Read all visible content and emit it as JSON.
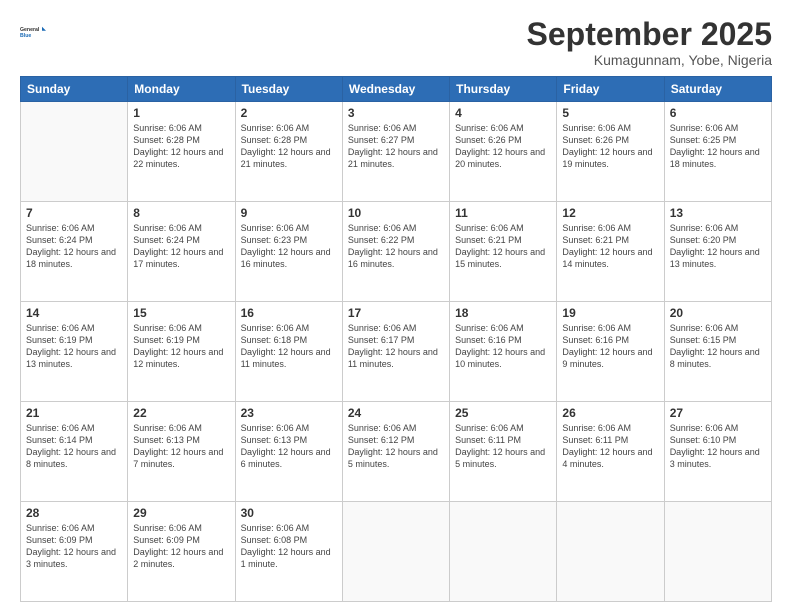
{
  "header": {
    "logo_line1": "General",
    "logo_line2": "Blue",
    "month": "September 2025",
    "location": "Kumagunnam, Yobe, Nigeria"
  },
  "weekdays": [
    "Sunday",
    "Monday",
    "Tuesday",
    "Wednesday",
    "Thursday",
    "Friday",
    "Saturday"
  ],
  "weeks": [
    [
      {
        "day": "",
        "sunrise": "",
        "sunset": "",
        "daylight": ""
      },
      {
        "day": "1",
        "sunrise": "Sunrise: 6:06 AM",
        "sunset": "Sunset: 6:28 PM",
        "daylight": "Daylight: 12 hours and 22 minutes."
      },
      {
        "day": "2",
        "sunrise": "Sunrise: 6:06 AM",
        "sunset": "Sunset: 6:28 PM",
        "daylight": "Daylight: 12 hours and 21 minutes."
      },
      {
        "day": "3",
        "sunrise": "Sunrise: 6:06 AM",
        "sunset": "Sunset: 6:27 PM",
        "daylight": "Daylight: 12 hours and 21 minutes."
      },
      {
        "day": "4",
        "sunrise": "Sunrise: 6:06 AM",
        "sunset": "Sunset: 6:26 PM",
        "daylight": "Daylight: 12 hours and 20 minutes."
      },
      {
        "day": "5",
        "sunrise": "Sunrise: 6:06 AM",
        "sunset": "Sunset: 6:26 PM",
        "daylight": "Daylight: 12 hours and 19 minutes."
      },
      {
        "day": "6",
        "sunrise": "Sunrise: 6:06 AM",
        "sunset": "Sunset: 6:25 PM",
        "daylight": "Daylight: 12 hours and 18 minutes."
      }
    ],
    [
      {
        "day": "7",
        "sunrise": "Sunrise: 6:06 AM",
        "sunset": "Sunset: 6:24 PM",
        "daylight": "Daylight: 12 hours and 18 minutes."
      },
      {
        "day": "8",
        "sunrise": "Sunrise: 6:06 AM",
        "sunset": "Sunset: 6:24 PM",
        "daylight": "Daylight: 12 hours and 17 minutes."
      },
      {
        "day": "9",
        "sunrise": "Sunrise: 6:06 AM",
        "sunset": "Sunset: 6:23 PM",
        "daylight": "Daylight: 12 hours and 16 minutes."
      },
      {
        "day": "10",
        "sunrise": "Sunrise: 6:06 AM",
        "sunset": "Sunset: 6:22 PM",
        "daylight": "Daylight: 12 hours and 16 minutes."
      },
      {
        "day": "11",
        "sunrise": "Sunrise: 6:06 AM",
        "sunset": "Sunset: 6:21 PM",
        "daylight": "Daylight: 12 hours and 15 minutes."
      },
      {
        "day": "12",
        "sunrise": "Sunrise: 6:06 AM",
        "sunset": "Sunset: 6:21 PM",
        "daylight": "Daylight: 12 hours and 14 minutes."
      },
      {
        "day": "13",
        "sunrise": "Sunrise: 6:06 AM",
        "sunset": "Sunset: 6:20 PM",
        "daylight": "Daylight: 12 hours and 13 minutes."
      }
    ],
    [
      {
        "day": "14",
        "sunrise": "Sunrise: 6:06 AM",
        "sunset": "Sunset: 6:19 PM",
        "daylight": "Daylight: 12 hours and 13 minutes."
      },
      {
        "day": "15",
        "sunrise": "Sunrise: 6:06 AM",
        "sunset": "Sunset: 6:19 PM",
        "daylight": "Daylight: 12 hours and 12 minutes."
      },
      {
        "day": "16",
        "sunrise": "Sunrise: 6:06 AM",
        "sunset": "Sunset: 6:18 PM",
        "daylight": "Daylight: 12 hours and 11 minutes."
      },
      {
        "day": "17",
        "sunrise": "Sunrise: 6:06 AM",
        "sunset": "Sunset: 6:17 PM",
        "daylight": "Daylight: 12 hours and 11 minutes."
      },
      {
        "day": "18",
        "sunrise": "Sunrise: 6:06 AM",
        "sunset": "Sunset: 6:16 PM",
        "daylight": "Daylight: 12 hours and 10 minutes."
      },
      {
        "day": "19",
        "sunrise": "Sunrise: 6:06 AM",
        "sunset": "Sunset: 6:16 PM",
        "daylight": "Daylight: 12 hours and 9 minutes."
      },
      {
        "day": "20",
        "sunrise": "Sunrise: 6:06 AM",
        "sunset": "Sunset: 6:15 PM",
        "daylight": "Daylight: 12 hours and 8 minutes."
      }
    ],
    [
      {
        "day": "21",
        "sunrise": "Sunrise: 6:06 AM",
        "sunset": "Sunset: 6:14 PM",
        "daylight": "Daylight: 12 hours and 8 minutes."
      },
      {
        "day": "22",
        "sunrise": "Sunrise: 6:06 AM",
        "sunset": "Sunset: 6:13 PM",
        "daylight": "Daylight: 12 hours and 7 minutes."
      },
      {
        "day": "23",
        "sunrise": "Sunrise: 6:06 AM",
        "sunset": "Sunset: 6:13 PM",
        "daylight": "Daylight: 12 hours and 6 minutes."
      },
      {
        "day": "24",
        "sunrise": "Sunrise: 6:06 AM",
        "sunset": "Sunset: 6:12 PM",
        "daylight": "Daylight: 12 hours and 5 minutes."
      },
      {
        "day": "25",
        "sunrise": "Sunrise: 6:06 AM",
        "sunset": "Sunset: 6:11 PM",
        "daylight": "Daylight: 12 hours and 5 minutes."
      },
      {
        "day": "26",
        "sunrise": "Sunrise: 6:06 AM",
        "sunset": "Sunset: 6:11 PM",
        "daylight": "Daylight: 12 hours and 4 minutes."
      },
      {
        "day": "27",
        "sunrise": "Sunrise: 6:06 AM",
        "sunset": "Sunset: 6:10 PM",
        "daylight": "Daylight: 12 hours and 3 minutes."
      }
    ],
    [
      {
        "day": "28",
        "sunrise": "Sunrise: 6:06 AM",
        "sunset": "Sunset: 6:09 PM",
        "daylight": "Daylight: 12 hours and 3 minutes."
      },
      {
        "day": "29",
        "sunrise": "Sunrise: 6:06 AM",
        "sunset": "Sunset: 6:09 PM",
        "daylight": "Daylight: 12 hours and 2 minutes."
      },
      {
        "day": "30",
        "sunrise": "Sunrise: 6:06 AM",
        "sunset": "Sunset: 6:08 PM",
        "daylight": "Daylight: 12 hours and 1 minute."
      },
      {
        "day": "",
        "sunrise": "",
        "sunset": "",
        "daylight": ""
      },
      {
        "day": "",
        "sunrise": "",
        "sunset": "",
        "daylight": ""
      },
      {
        "day": "",
        "sunrise": "",
        "sunset": "",
        "daylight": ""
      },
      {
        "day": "",
        "sunrise": "",
        "sunset": "",
        "daylight": ""
      }
    ]
  ]
}
